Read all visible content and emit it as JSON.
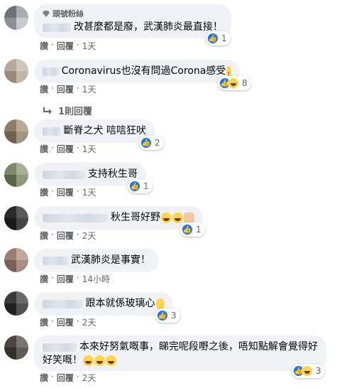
{
  "badge": {
    "label": "頭號粉絲",
    "icon": "diamond-icon"
  },
  "actions_labels": {
    "like": "讚",
    "reply": "回覆",
    "dot": "·"
  },
  "replies_link": {
    "label": "1則回覆",
    "icon": "reply-arrow-icon"
  },
  "colors": {
    "bubble": "#f0f2f5",
    "like_blue": "#1877f2",
    "meta_gray": "#65676b"
  },
  "comments": [
    {
      "text": "改甚麼都是廢，武漢肺炎最直接！",
      "time": "1天",
      "reactions": "1",
      "reaction_types": [
        "like"
      ]
    },
    {
      "text": "Coronavirus也沒有問過Corona感受",
      "emoji": [
        "laugh"
      ],
      "time": "1天",
      "reactions": "8",
      "reaction_types": [
        "like",
        "haha"
      ]
    },
    {
      "text": "斷脊之犬 唁唁狂吠",
      "time": "1天",
      "reactions": "2",
      "reaction_types": [
        "like"
      ]
    },
    {
      "text": "支持秋生哥",
      "time": "1天",
      "reactions": "1",
      "reaction_types": [
        "like"
      ]
    },
    {
      "text": "秋生哥好野",
      "emoji": [
        "laugh",
        "laugh",
        "thumb"
      ],
      "time": "2天",
      "reactions": "1",
      "reaction_types": [
        "like"
      ]
    },
    {
      "text": "武漢肺炎是事實！",
      "time": "14小時",
      "reactions": "",
      "reaction_types": []
    },
    {
      "text": "跟本就係玻璃心",
      "emoji": [
        "pray"
      ],
      "time": "2天",
      "reactions": "3",
      "reaction_types": [
        "like"
      ]
    },
    {
      "text_line1": "本來好努氣嘅事，睇完呢段嘢之後，唔知點解會覺得好",
      "text_line2": "好笑嘅！",
      "emoji": [
        "laugh",
        "laugh",
        "laugh"
      ],
      "time": "2天",
      "reactions": "3",
      "reaction_types": [
        "like",
        "haha"
      ]
    }
  ]
}
